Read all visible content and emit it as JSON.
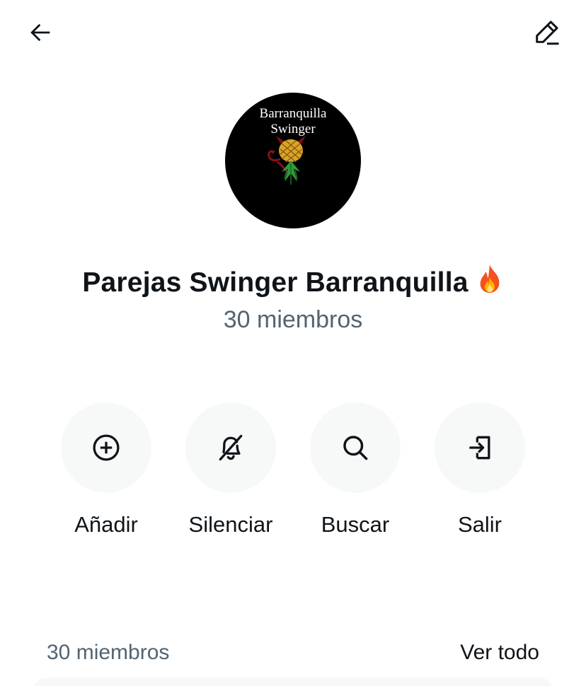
{
  "header": {
    "back_icon": "arrow-left-icon",
    "edit_icon": "edit-pencil-icon"
  },
  "group": {
    "avatar_text_line1": "Barranquilla",
    "avatar_text_line2": "Swinger",
    "avatar_background": "#000000",
    "name": "Parejas Swinger Barranquilla",
    "name_emoji_icon": "fire-icon",
    "subtitle": "30 miembros"
  },
  "actions": [
    {
      "label": "Añadir",
      "icon": "plus-circle-icon"
    },
    {
      "label": "Silenciar",
      "icon": "bell-off-icon"
    },
    {
      "label": "Buscar",
      "icon": "search-icon"
    },
    {
      "label": "Salir",
      "icon": "exit-icon"
    }
  ],
  "members": {
    "count_label": "30 miembros",
    "see_all_label": "Ver todo"
  },
  "colors": {
    "text_primary": "#0f1419",
    "text_secondary": "#536471",
    "button_background": "#f7f9f9"
  }
}
